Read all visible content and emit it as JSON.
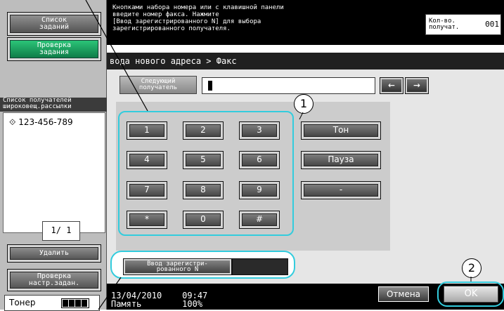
{
  "sidebar": {
    "job_list_label": "Список\nзаданий",
    "check_job_label": "Проверка\nзадания",
    "broadcast_header": "Список получателей\nшироковещ.рассылки",
    "broadcast_recipient": "123-456-789",
    "page_counter": "1/  1",
    "delete_label": "Удалить",
    "check_settings_label": "Проверка\nнастр.задан.",
    "toner_label": "Тонер"
  },
  "message": {
    "text": "Кнопками набора номера или с клавишной панели\nвведите номер факса. Нажмите\n[Ввод зарегистрированного N] для выбора\nзарегистрированного получателя.",
    "count_label": "Кол-во.\nполучат.",
    "count_value": "001"
  },
  "screen": {
    "breadcrumb": "вода нового адреса > Факс",
    "next_recipient_label": "Следующий\nполучатель",
    "fax_number_value": "",
    "left_arrow": "←",
    "right_arrow": "→"
  },
  "keypad": {
    "keys": [
      "1",
      "2",
      "3",
      "4",
      "5",
      "6",
      "7",
      "8",
      "9",
      "*",
      "0",
      "#"
    ],
    "tone_label": "Тон",
    "pause_label": "Пауза",
    "dash_label": "-"
  },
  "register": {
    "label": "Ввод зарегистри-\nрованного N"
  },
  "status": {
    "datetime": "13/04/2010    09:47",
    "memory": "Память        100%"
  },
  "actions": {
    "cancel_label": "Отмена",
    "ok_label": "OK"
  },
  "callouts": {
    "c1": "1",
    "c2": "2"
  },
  "colors": {
    "highlight": "#33ccdd",
    "primary_green": "#1aa85e"
  }
}
